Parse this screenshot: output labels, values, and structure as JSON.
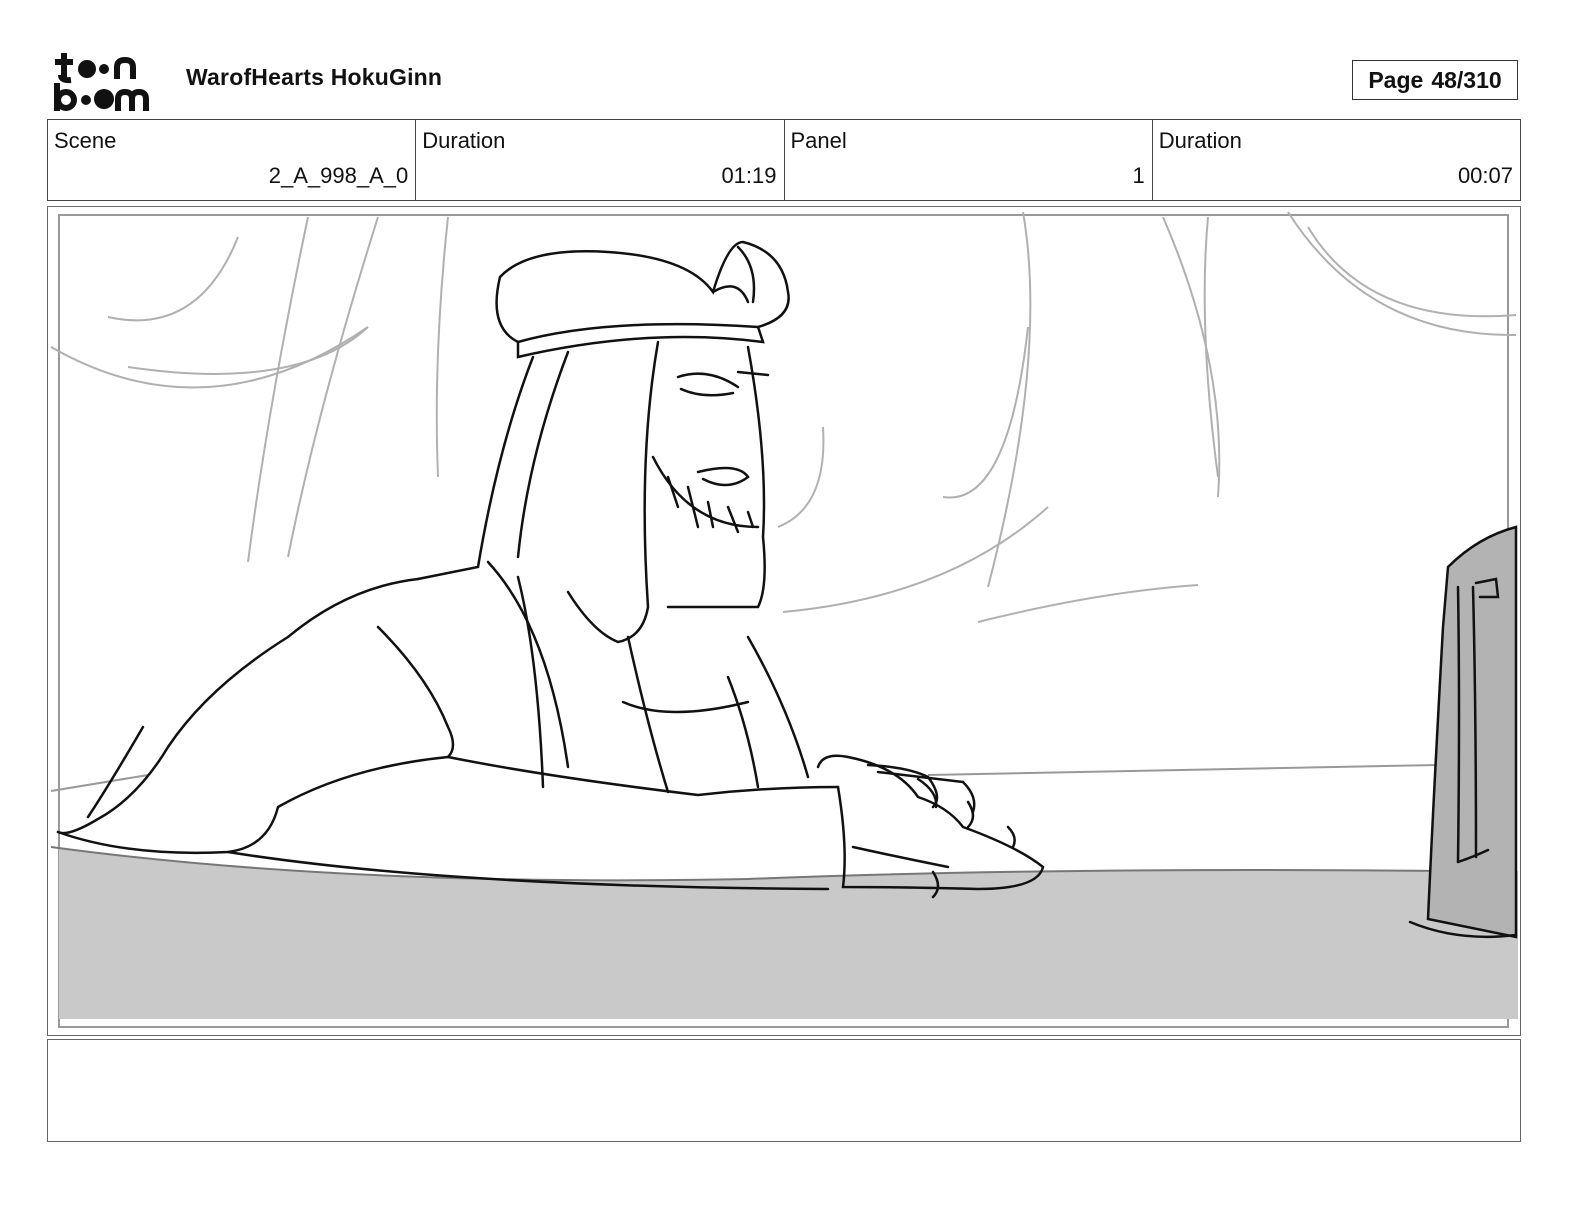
{
  "header": {
    "logo_icon": "toonboom-logo",
    "project_title": "WarofHearts HokuGinn",
    "page_label": "Page",
    "page_number": "48/310"
  },
  "info": [
    {
      "label": "Scene",
      "value": "2_A_998_A_0"
    },
    {
      "label": "Duration",
      "value": "01:19"
    },
    {
      "label": "Panel",
      "value": "1"
    },
    {
      "label": "Duration",
      "value": "00:07"
    }
  ],
  "panel": {
    "image_icon": "storyboard-sketch-image"
  },
  "notes": {
    "text": ""
  },
  "colors": {
    "table_gray": "#c9c9c9",
    "screen_gray": "#b3b3b3",
    "line": "#111111",
    "construction": "#a8a8a8"
  }
}
